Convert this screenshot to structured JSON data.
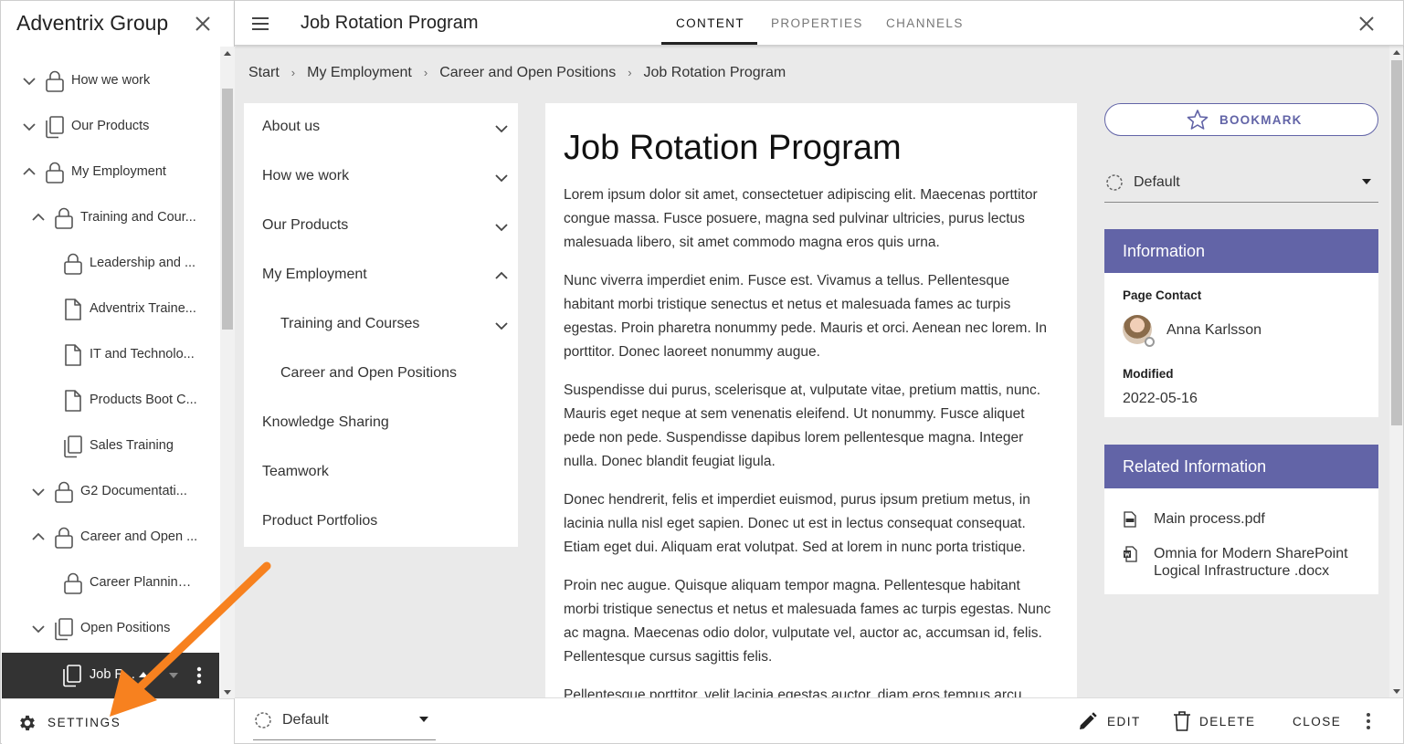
{
  "left_panel": {
    "site_title": "Adventrix Group",
    "tree": [
      {
        "label": "How we work",
        "icon": "lock-icon",
        "chevron": "down"
      },
      {
        "label": "Our Products",
        "icon": "pages-icon",
        "chevron": "down"
      },
      {
        "label": "My Employment",
        "icon": "lock-icon",
        "chevron": "up"
      },
      {
        "label": "Training and Cour...",
        "icon": "lock-icon",
        "chevron": "up"
      },
      {
        "label": "Leadership and ...",
        "icon": "lock-icon",
        "chevron": ""
      },
      {
        "label": "Adventrix Traine...",
        "icon": "page-icon",
        "chevron": ""
      },
      {
        "label": "IT and Technolo...",
        "icon": "page-icon",
        "chevron": ""
      },
      {
        "label": "Products Boot C...",
        "icon": "page-icon",
        "chevron": ""
      },
      {
        "label": "Sales Training",
        "icon": "pages-icon",
        "chevron": ""
      },
      {
        "label": "G2 Documentati...",
        "icon": "lock-icon",
        "chevron": "down"
      },
      {
        "label": "Career and Open ...",
        "icon": "lock-icon",
        "chevron": "up"
      },
      {
        "label": "Career Planning ...",
        "icon": "lock-icon",
        "chevron": ""
      },
      {
        "label": "Open Positions",
        "icon": "pages-icon",
        "chevron": "down"
      }
    ],
    "selected_item": {
      "label": "Job R...",
      "icon": "pages-icon"
    },
    "settings_label": "SETTINGS"
  },
  "topbar": {
    "page_title": "Job Rotation Program",
    "tabs": [
      {
        "label": "CONTENT",
        "active": true
      },
      {
        "label": "PROPERTIES",
        "active": false
      },
      {
        "label": "CHANNELS",
        "active": false
      }
    ]
  },
  "breadcrumb": [
    "Start",
    "My Employment",
    "Career and Open Positions",
    "Job Rotation Program"
  ],
  "page_nav": [
    {
      "label": "About us",
      "chevron": "down",
      "level": 0
    },
    {
      "label": "How we work",
      "chevron": "down",
      "level": 0
    },
    {
      "label": "Our Products",
      "chevron": "down",
      "level": 0
    },
    {
      "label": "My Employment",
      "chevron": "up",
      "level": 0
    },
    {
      "label": "Training and Courses",
      "chevron": "down",
      "level": 1
    },
    {
      "label": "Career and Open Positions",
      "chevron": "",
      "level": 1
    },
    {
      "label": "Knowledge Sharing",
      "chevron": "",
      "level": 0
    },
    {
      "label": "Teamwork",
      "chevron": "",
      "level": 0
    },
    {
      "label": "Product Portfolios",
      "chevron": "",
      "level": 0
    }
  ],
  "article": {
    "title": "Job Rotation Program",
    "paragraphs": [
      "Lorem ipsum dolor sit amet, consectetuer adipiscing elit. Maecenas porttitor congue massa. Fusce posuere, magna sed pulvinar ultricies, purus lectus malesuada libero, sit amet commodo magna eros quis urna.",
      "Nunc viverra imperdiet enim. Fusce est. Vivamus a tellus. Pellentesque habitant morbi tristique senectus et netus et malesuada fames ac turpis egestas. Proin pharetra nonummy pede. Mauris et orci. Aenean nec lorem. In porttitor. Donec laoreet nonummy augue.",
      "Suspendisse dui purus, scelerisque at, vulputate vitae, pretium mattis, nunc. Mauris eget neque at sem venenatis eleifend. Ut nonummy. Fusce aliquet pede non pede. Suspendisse dapibus lorem pellentesque magna. Integer nulla. Donec blandit feugiat ligula.",
      "Donec hendrerit, felis et imperdiet euismod, purus ipsum pretium metus, in lacinia nulla nisl eget sapien. Donec ut est in lectus consequat consequat. Etiam eget dui. Aliquam erat volutpat. Sed at lorem in nunc porta tristique.",
      "Proin nec augue. Quisque aliquam tempor magna. Pellentesque habitant morbi tristique senectus et netus et malesuada fames ac turpis egestas. Nunc ac magna. Maecenas odio dolor, vulputate vel, auctor ac, accumsan id, felis. Pellentesque cursus sagittis felis.",
      "Pellentesque porttitor, velit lacinia egestas auctor, diam eros tempus arcu"
    ]
  },
  "right_column": {
    "bookmark_label": "BOOKMARK",
    "layout_value": "Default",
    "information": {
      "header": "Information",
      "page_contact_label": "Page Contact",
      "contact_name": "Anna Karlsson",
      "modified_label": "Modified",
      "modified_value": "2022-05-16"
    },
    "related": {
      "header": "Related Information",
      "documents": [
        {
          "name": "Main process.pdf",
          "icon": "pdf-file-icon"
        },
        {
          "name": "Omnia for Modern SharePoint Logical Infrastructure .docx",
          "icon": "word-file-icon"
        }
      ]
    }
  },
  "bottombar": {
    "layout_value": "Default",
    "edit_label": "EDIT",
    "delete_label": "DELETE",
    "close_label": "CLOSE"
  },
  "colors": {
    "accent": "#6264a7",
    "annotation_arrow": "#f7811f",
    "selected_bg": "#333333",
    "main_bg": "#eaeaea"
  }
}
